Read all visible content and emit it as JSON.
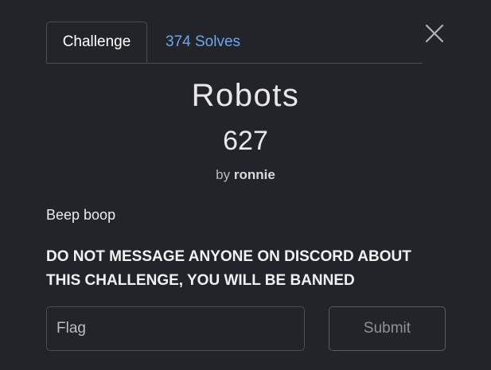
{
  "tabs": {
    "challenge_label": "Challenge",
    "solves_label": "374 Solves"
  },
  "close": {
    "icon": "close-icon"
  },
  "challenge": {
    "name": "Robots",
    "points": "627",
    "author_prefix": "by",
    "author": "ronnie",
    "description_line1": "Beep boop",
    "description_line2": "DO NOT MESSAGE ANYONE ON DISCORD ABOUT THIS CHALLENGE, YOU WILL BE BANNED"
  },
  "form": {
    "flag_placeholder": "Flag",
    "submit_label": "Submit"
  },
  "colors": {
    "background": "#232429",
    "link": "#6ea6ee",
    "border": "#4a4c52"
  }
}
